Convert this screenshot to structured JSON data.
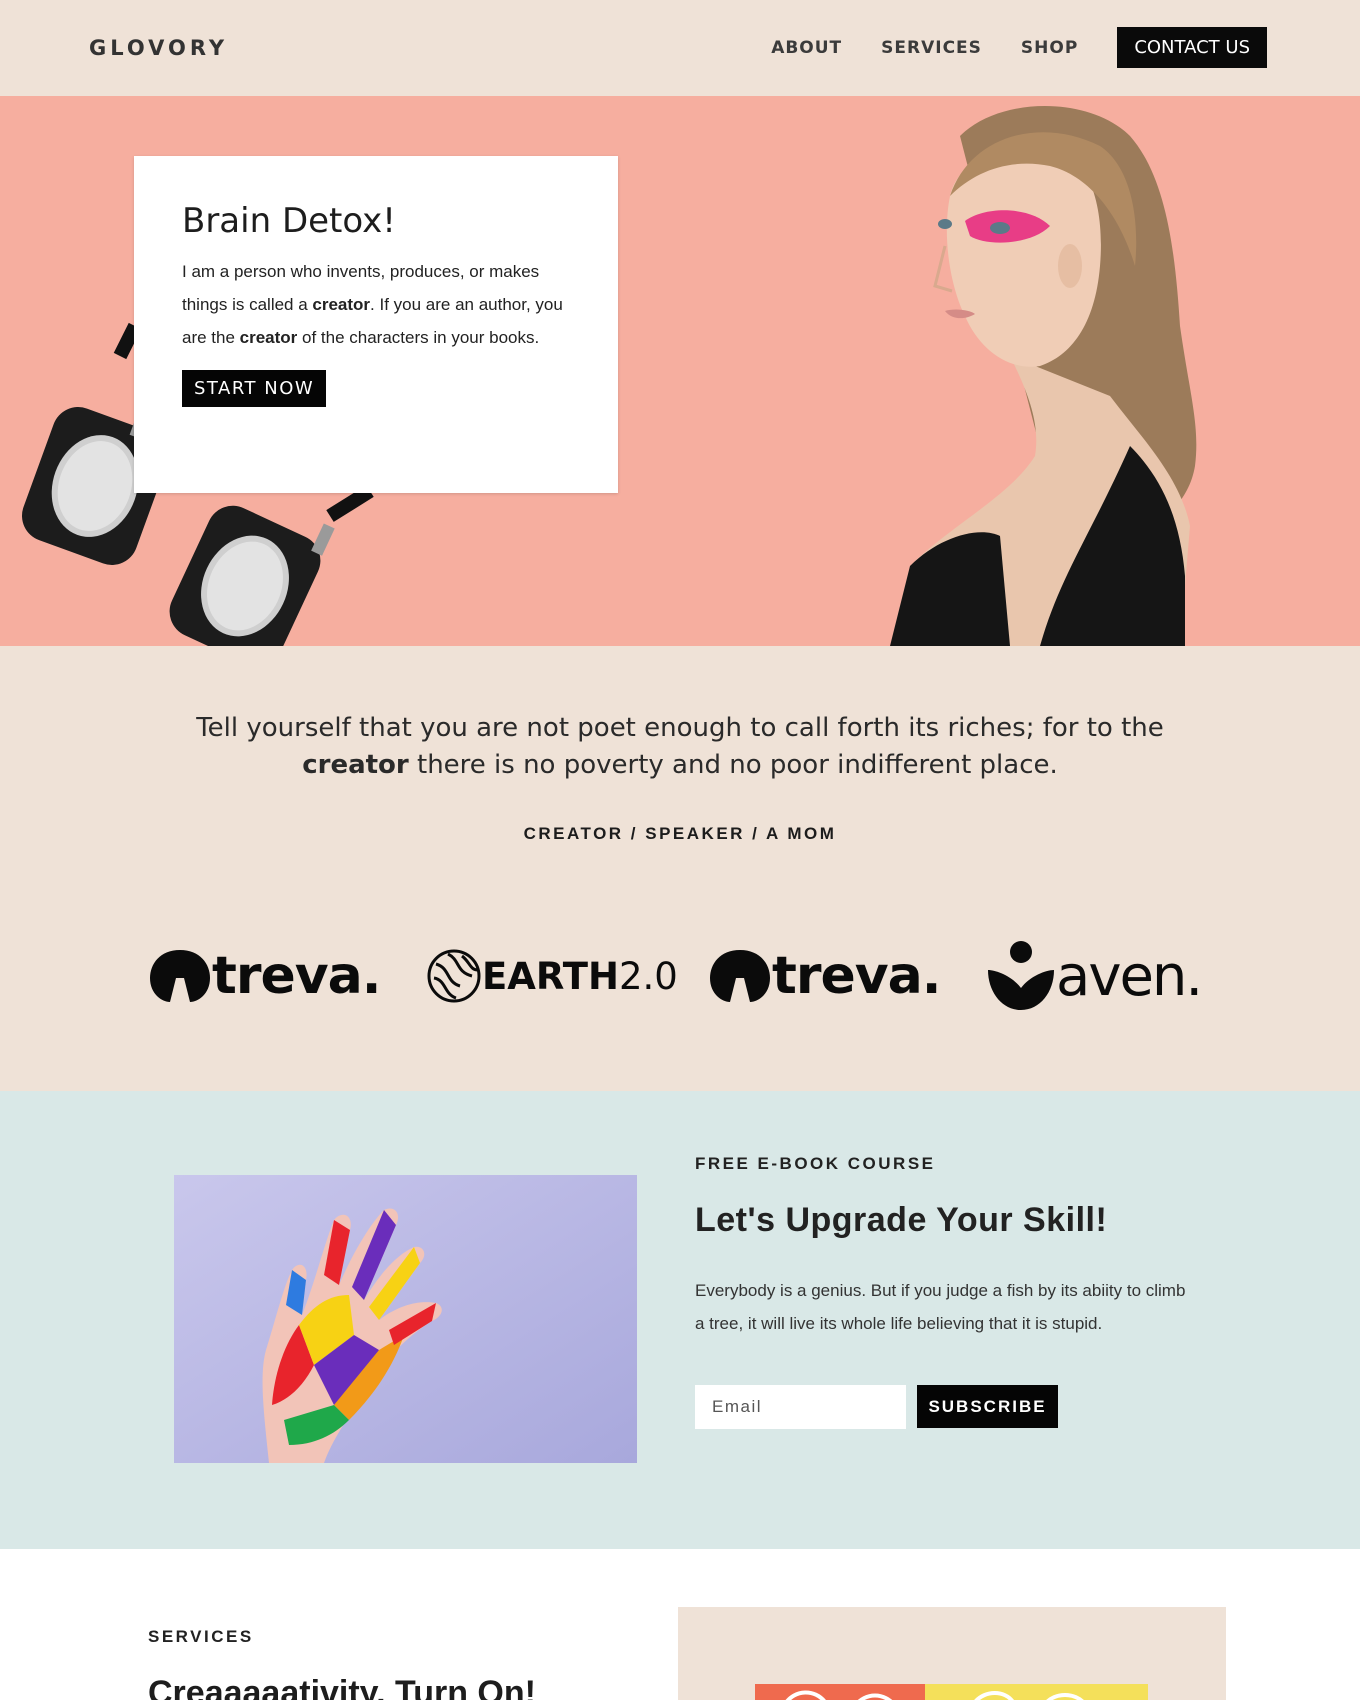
{
  "header": {
    "logo": "GLOVORY",
    "nav": {
      "about": "ABOUT",
      "services": "SERVICES",
      "shop": "SHOP",
      "contact": "CONTACT US"
    }
  },
  "hero": {
    "title": "Brain Detox!",
    "text_1": "I am a person who invents, produces, or makes things is called a ",
    "bold_1": "creator",
    "text_2": ". If you are an author, you are the ",
    "bold_2": "creator",
    "text_3": " of the characters in your books.",
    "button": "START NOW"
  },
  "quote": {
    "text_1": "Tell yourself that you are not poet enough to call forth its riches; for to the ",
    "bold": "creator",
    "text_2": " there is no poverty and no poor indifferent place.",
    "roles": "CREATOR / SPEAKER / A MOM"
  },
  "logos": {
    "treva_1": "treva.",
    "earth_bold": "EARTH",
    "earth_thin": "2.0",
    "treva_2": "treva.",
    "aven": "aven."
  },
  "ebook": {
    "label": "FREE E-BOOK COURSE",
    "title": "Let's Upgrade Your Skill!",
    "text": "Everybody is a genius. But if you judge a fish by its abiity to climb a tree, it will live its whole life believing that it is stupid.",
    "email_placeholder": "Email",
    "subscribe": "SUBSCRIBE"
  },
  "services": {
    "label": "SERVICES",
    "title": "Creaaaaativity, Turn On!"
  },
  "colors": {
    "header_bg": "#efe2d7",
    "hero_bg": "#f6ae9f",
    "ebook_bg": "#d9e8e7",
    "button_bg": "#050505"
  }
}
